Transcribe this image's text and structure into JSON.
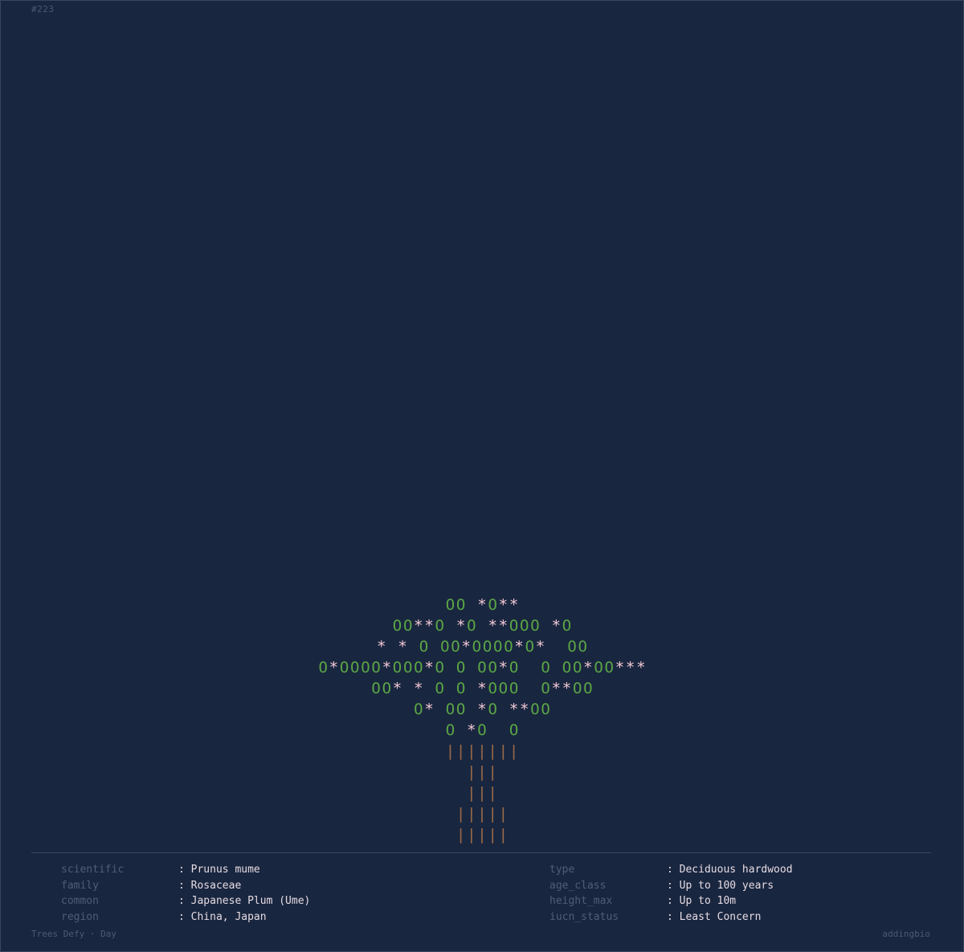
{
  "serial": "#223",
  "tree": {
    "rows": [
      "OO *O**",
      "OO**O *O **OOO *O",
      "* * O OO*OOOO*O*  OO",
      "O*OOOO*OOO*O O OO*O  O OO*OO***",
      "OO* * O O *OOO  O**OO",
      "O* OO *O **OO",
      "O *O  O",
      "|||||||",
      "|||",
      "|||",
      "|||||",
      "|||||"
    ]
  },
  "details_left": [
    {
      "key": "scientific",
      "value": ": Prunus mume"
    },
    {
      "key": "family",
      "value": ": Rosaceae"
    },
    {
      "key": "common",
      "value": ": Japanese Plum (Ume)"
    },
    {
      "key": "region",
      "value": ": China, Japan"
    }
  ],
  "details_right": [
    {
      "key": "type",
      "value": ": Deciduous hardwood"
    },
    {
      "key": "age_class",
      "value": ": Up to 100 years"
    },
    {
      "key": "height_max",
      "value": ": Up to 10m"
    },
    {
      "key": "iucn_status",
      "value": ": Least Concern"
    }
  ],
  "footer": {
    "left": "Trees Defy · Day",
    "right": "addingbio"
  },
  "colors": {
    "background": "#19263f",
    "leaf": "#5aa646",
    "blossom": "#f3c9d6",
    "trunk": "#9a6a48",
    "label": "#4f5d78",
    "value": "#e6dce4"
  }
}
